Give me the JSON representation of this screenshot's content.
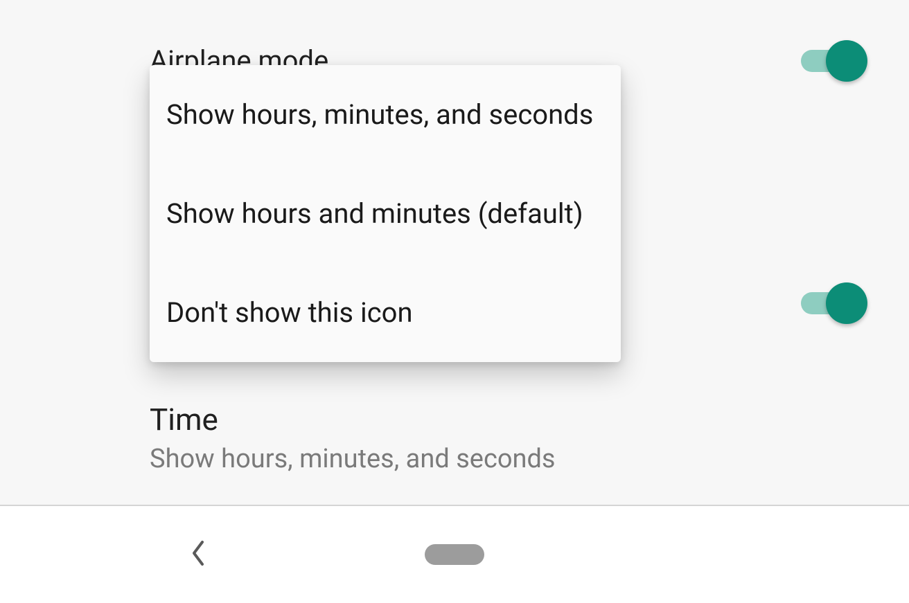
{
  "settings": {
    "row1": {
      "title": "Airplane mode",
      "toggle_on": true
    },
    "row2": {
      "title": "",
      "toggle_on": false
    },
    "row3": {
      "title": "",
      "toggle_on": true
    },
    "row4": {
      "title": "Time",
      "subtitle": "Show hours, minutes, and seconds"
    }
  },
  "dialog": {
    "options": [
      "Show hours, minutes, and seconds",
      "Show hours and minutes (default)",
      "Don't show this icon"
    ]
  },
  "colors": {
    "switch_thumb": "#0c8d77",
    "switch_track": "#8ecdc0"
  }
}
